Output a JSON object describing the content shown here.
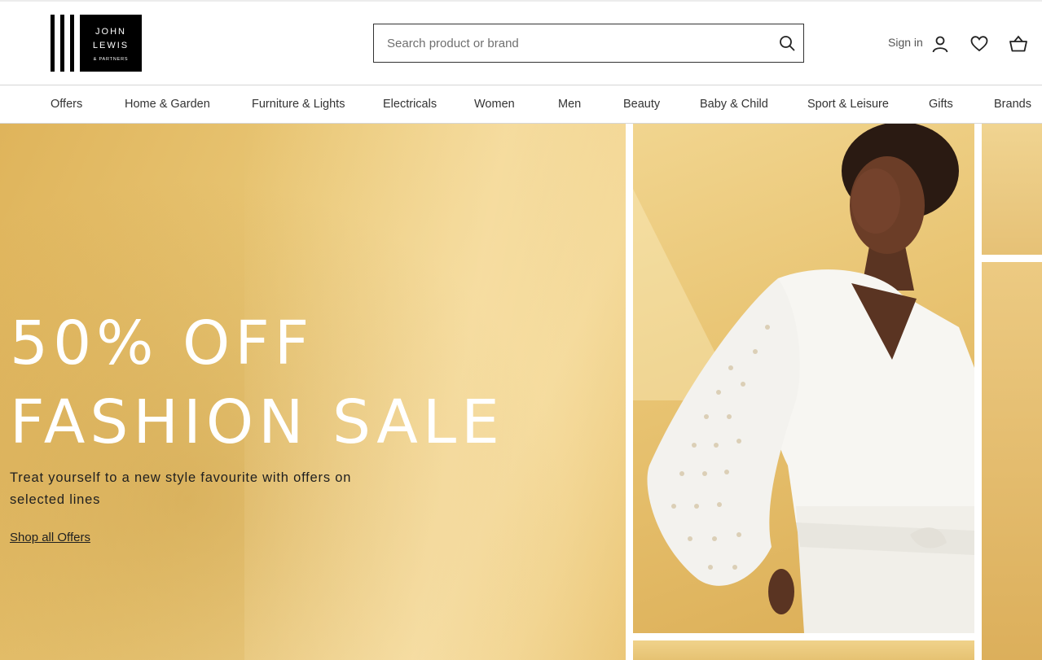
{
  "brand": {
    "logo_line1": "JOHN",
    "logo_line2": "LEWIS",
    "logo_line3": "& PARTNERS"
  },
  "header": {
    "search_placeholder": "Search product or brand",
    "signin_label": "Sign in",
    "icons": [
      "search-icon",
      "account-icon",
      "heart-icon",
      "basket-icon"
    ]
  },
  "nav": {
    "items": [
      {
        "label": "Offers"
      },
      {
        "label": "Home & Garden"
      },
      {
        "label": "Furniture & Lights"
      },
      {
        "label": "Electricals"
      },
      {
        "label": "Women"
      },
      {
        "label": "Men"
      },
      {
        "label": "Beauty"
      },
      {
        "label": "Baby & Child"
      },
      {
        "label": "Sport & Leisure"
      },
      {
        "label": "Gifts"
      },
      {
        "label": "Brands"
      }
    ]
  },
  "hero": {
    "title_line1": "50% OFF",
    "title_line2": "FASHION SALE",
    "subtitle": "Treat yourself to a new style favourite with offers on selected lines",
    "link_label": "Shop all Offers"
  },
  "colors": {
    "hero_yellow": "#e9c776",
    "text_dark": "#1f1f1f",
    "white": "#ffffff"
  }
}
